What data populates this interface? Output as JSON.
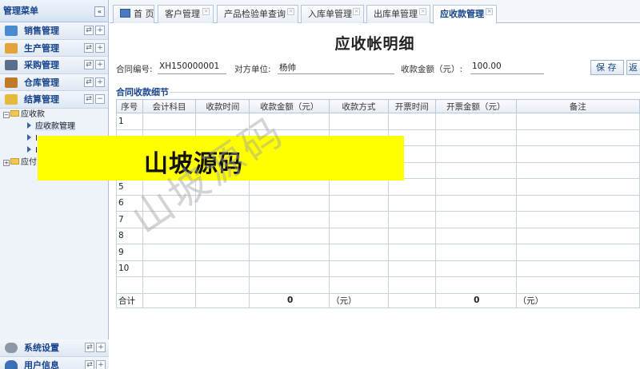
{
  "sidebar": {
    "title": "管理菜单",
    "collapse": "«",
    "menus": [
      {
        "label": "销售管理",
        "icon": "register-icon",
        "color": "#4a8ad1"
      },
      {
        "label": "生产管理",
        "icon": "wrench-icon",
        "color": "#e3a33b"
      },
      {
        "label": "采购管理",
        "icon": "truck-icon",
        "color": "#5b6e8a"
      },
      {
        "label": "仓库管理",
        "icon": "warehouse-icon",
        "color": "#c27a2a"
      },
      {
        "label": "结算管理",
        "icon": "coins-icon",
        "color": "#e5b93a"
      }
    ],
    "tree": {
      "receivable": "应收款",
      "receivable_mgmt": "应收款管理",
      "child2": "I",
      "child3": "I",
      "payable": "应付"
    },
    "bottom": [
      {
        "label": "系统设置",
        "icon": "gear-icon",
        "color": "#8c98a6"
      },
      {
        "label": "用户信息",
        "icon": "user-icon",
        "color": "#3d6fb5"
      }
    ],
    "ctrl_a": "⇄",
    "ctrl_b_plus": "+",
    "ctrl_b_minus": "−"
  },
  "tabs": [
    {
      "label": "首 页"
    },
    {
      "label": "客户管理"
    },
    {
      "label": "产品检验单查询"
    },
    {
      "label": "入库单管理"
    },
    {
      "label": "出库单管理"
    },
    {
      "label": "应收款管理"
    }
  ],
  "tab_close": "×",
  "form": {
    "title": "应收帐明细",
    "contract_label": "合同编号:",
    "contract_value": "XH150000001",
    "party_label": "对方单位:",
    "party_value": "杨帅",
    "amount_label": "收款金额（元）:",
    "amount_value": "100.00",
    "save": "保 存",
    "back": "返"
  },
  "section_title": "合同收款细节",
  "table": {
    "headers": [
      "序号",
      "会计科目",
      "收款时间",
      "收款金额（元）",
      "收款方式",
      "开票时间",
      "开票金额（元）",
      "备注"
    ],
    "rows": [
      "1",
      "",
      "",
      "",
      "5",
      "6",
      "7",
      "8",
      "9",
      "10",
      ""
    ],
    "total_label": "合计",
    "total_amount": "0",
    "total_unit1": "（元）",
    "total_invoice": "0",
    "total_unit2": "（元）"
  },
  "watermark": {
    "band_text": "山坡源码",
    "diag_text": "山坡源码",
    "band_color": "#ffff00"
  }
}
